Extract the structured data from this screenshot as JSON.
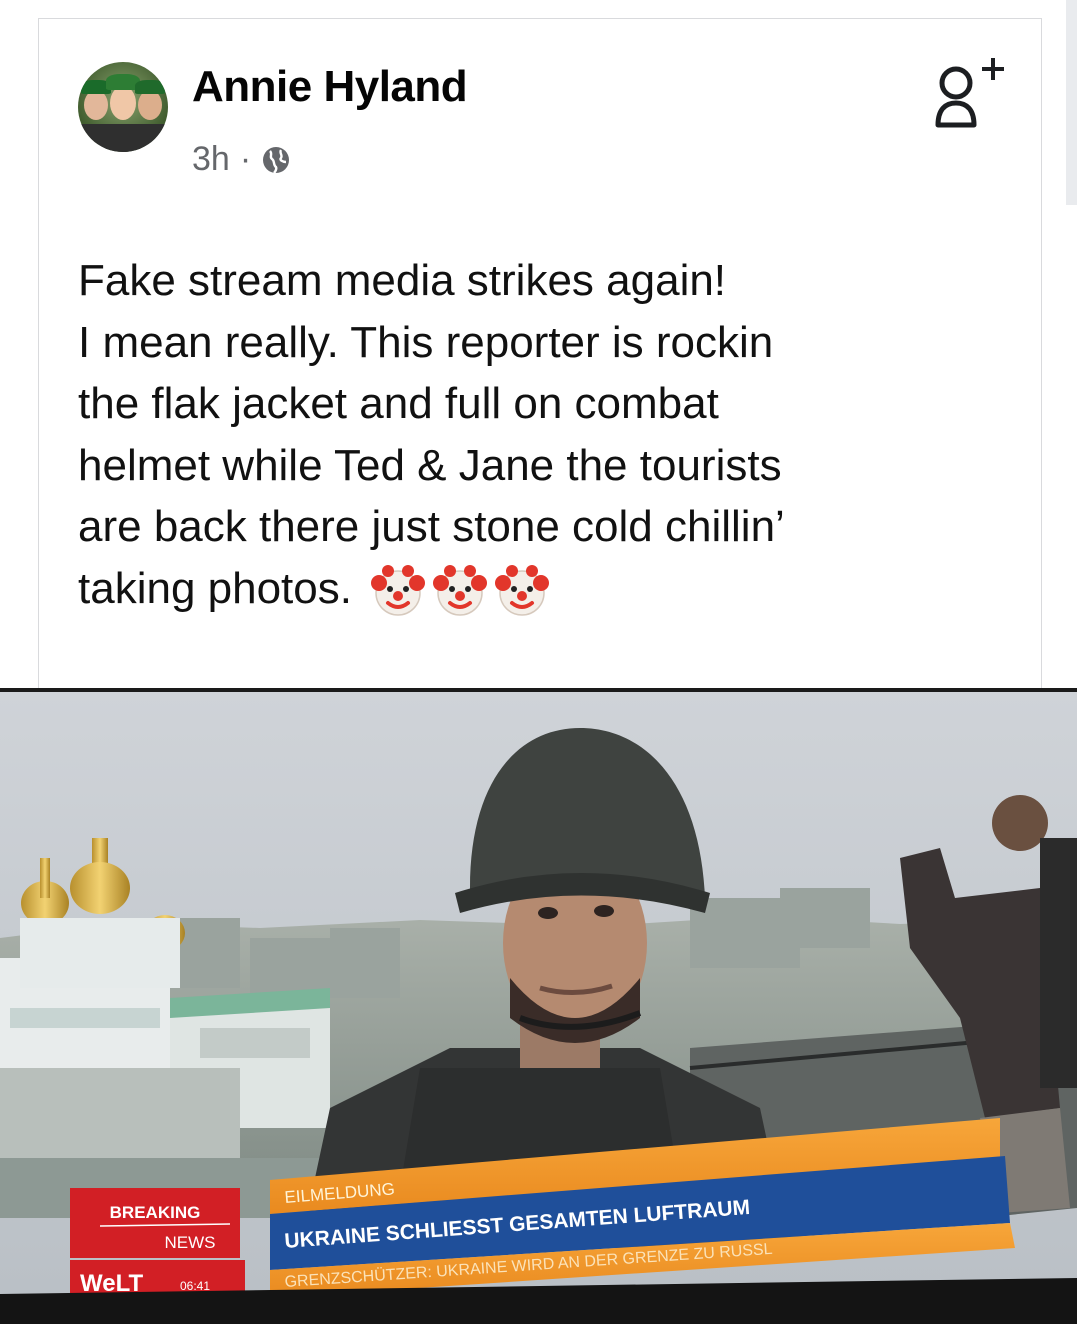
{
  "post": {
    "author": "Annie Hyland",
    "time": "3h",
    "separator": "·",
    "lines": [
      "Fake stream media strikes again!",
      "I mean really. This reporter is rockin",
      "the flak jacket and full on combat",
      "helmet while Ted & Jane the tourists",
      "are back there just stone cold chillin’",
      "taking photos."
    ],
    "emoji": [
      "🤡",
      "🤡",
      "🤡"
    ]
  },
  "tv": {
    "breaking": "BREAKING",
    "news": "NEWS",
    "channel": "WeLT",
    "clock": "06:41",
    "tag": "EILMELDUNG",
    "headline": "UKRAINE SCHLIESST GESAMTEN LUFTRAUM",
    "ticker": "GRENZSCHÜTZER: UKRAINE WIRD AN DER GRENZE ZU RUSSL"
  },
  "icons": {
    "avatar": "avatar",
    "visibility": "globe-icon",
    "add_friend": "add-friend-icon",
    "emoji": "clown-face-icon"
  },
  "colors": {
    "name": "#050505",
    "meta": "#65676b",
    "ticker_red": "#d21f25",
    "ticker_orange": "#f39a2b",
    "ticker_blue": "#1f4f9a"
  }
}
